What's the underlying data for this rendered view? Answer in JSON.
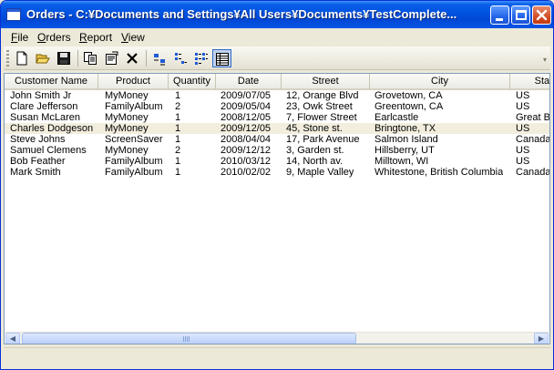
{
  "window": {
    "title": "Orders - C:¥Documents and Settings¥All Users¥Documents¥TestComplete..."
  },
  "menu": [
    {
      "label": "File",
      "accel": "F",
      "rest": "ile"
    },
    {
      "label": "Orders",
      "accel": "O",
      "rest": "rders"
    },
    {
      "label": "Report",
      "accel": "R",
      "rest": "eport"
    },
    {
      "label": "View",
      "accel": "V",
      "rest": "iew"
    }
  ],
  "toolbar": {
    "buttons": [
      "new-icon",
      "open-folder-icon",
      "save-icon",
      "copy-icon",
      "properties-icon",
      "delete-icon",
      "large-icons-view-icon",
      "small-icons-view-icon",
      "list-view-icon",
      "details-view-icon"
    ]
  },
  "table": {
    "columns": [
      "Customer Name",
      "Product",
      "Quantity",
      "Date",
      "Street",
      "City",
      "State"
    ],
    "rows": [
      [
        "John Smith Jr",
        "MyMoney",
        "1",
        "2009/07/05",
        "12, Orange Blvd",
        "Grovetown, CA",
        "US"
      ],
      [
        "Clare Jefferson",
        "FamilyAlbum",
        "2",
        "2009/05/04",
        "23, Owk Street",
        "Greentown, CA",
        "US"
      ],
      [
        "Susan McLaren",
        "MyMoney",
        "1",
        "2008/12/05",
        "7, Flower Street",
        "Earlcastle",
        "Great Britain"
      ],
      [
        "Charles Dodgeson",
        "MyMoney",
        "1",
        "2009/12/05",
        "45, Stone st.",
        "Bringtone, TX",
        "US"
      ],
      [
        "Steve Johns",
        "ScreenSaver",
        "1",
        "2008/04/04",
        "17, Park Avenue",
        "Salmon Island",
        "Canada"
      ],
      [
        "Samuel Clemens",
        "MyMoney",
        "2",
        "2009/12/12",
        "3, Garden st.",
        "Hillsberry, UT",
        "US"
      ],
      [
        "Bob Feather",
        "FamilyAlbum",
        "1",
        "2010/03/12",
        "14, North av.",
        "Milltown, WI",
        "US"
      ],
      [
        "Mark Smith",
        "FamilyAlbum",
        "1",
        "2010/02/02",
        "9, Maple Valley",
        "Whitestone, British Columbia",
        "Canada"
      ]
    ],
    "selected_row": 3
  },
  "colors": {
    "title_bar": "#0052e0",
    "selection": "#f2eede"
  }
}
